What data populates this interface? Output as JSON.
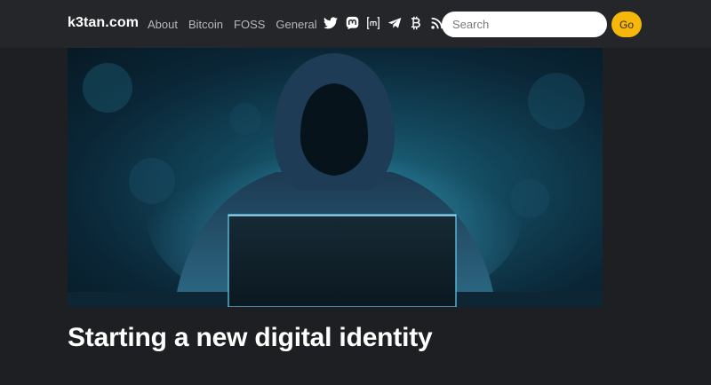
{
  "site": {
    "brand": "k3tan.com"
  },
  "nav": {
    "items": [
      {
        "label": "About"
      },
      {
        "label": "Bitcoin"
      },
      {
        "label": "FOSS"
      },
      {
        "label": "General"
      }
    ]
  },
  "social_icons": [
    "twitter-icon",
    "mastodon-icon",
    "matrix-icon",
    "telegram-icon",
    "bitcoin-icon",
    "rss-icon"
  ],
  "search": {
    "placeholder": "Search",
    "value": "",
    "button_label": "Go"
  },
  "post": {
    "title": "Starting a new digital identity"
  },
  "colors": {
    "background": "#1e1f22",
    "header": "#25262a",
    "accent": "#f5b70a",
    "nav_text": "#b7b8bd"
  }
}
